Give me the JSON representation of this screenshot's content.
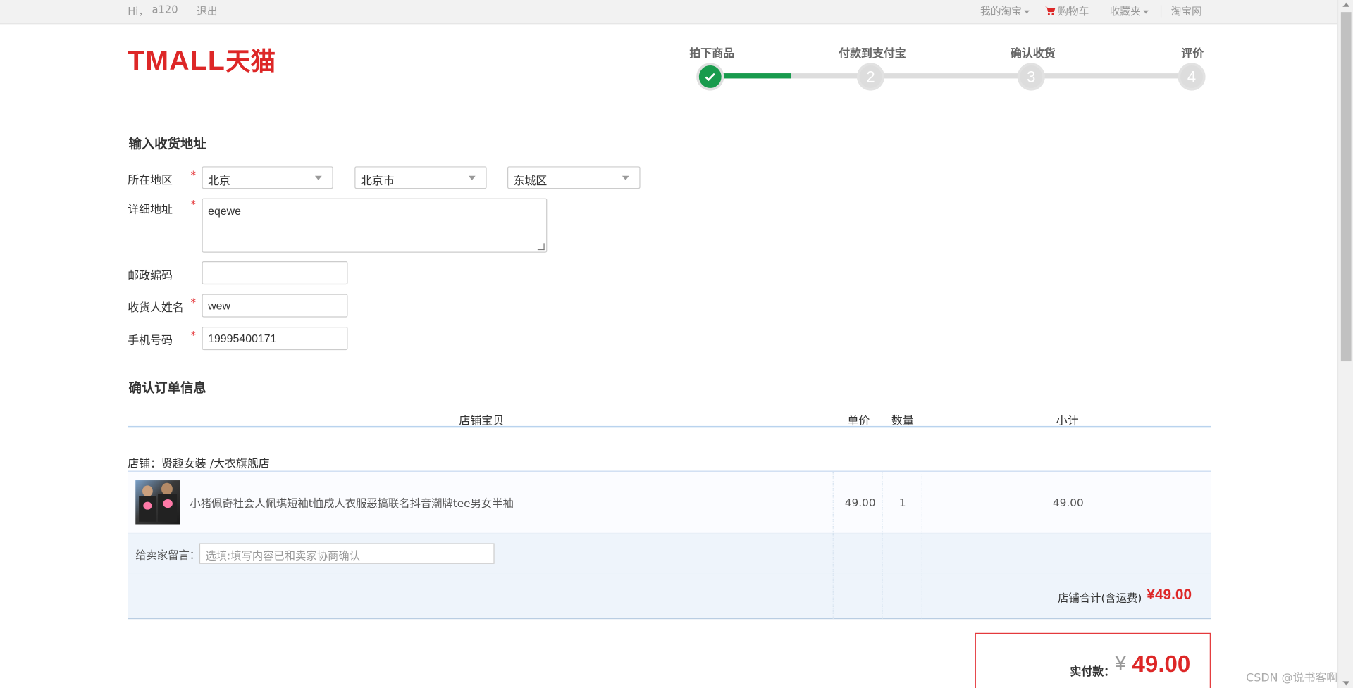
{
  "topbar": {
    "greeting": "Hi，",
    "username": "a120",
    "logout": "退出",
    "my_taobao": "我的淘宝",
    "cart": "购物车",
    "favorites": "收藏夹",
    "taobao_site": "淘宝网"
  },
  "logo": {
    "latin": "TMALL",
    "cn": "天猫"
  },
  "steps": [
    {
      "label": "拍下商品",
      "number": "",
      "done": true
    },
    {
      "label": "付款到支付宝",
      "number": "2",
      "done": false
    },
    {
      "label": "确认收货",
      "number": "3",
      "done": false
    },
    {
      "label": "评价",
      "number": "4",
      "done": false
    }
  ],
  "address": {
    "title": "输入收货地址",
    "region_label": "所在地区",
    "province": "北京",
    "city": "北京市",
    "district": "东城区",
    "detail_label": "详细地址",
    "detail_value": "eqewe",
    "postcode_label": "邮政编码",
    "postcode_value": "",
    "receiver_label": "收货人姓名",
    "receiver_value": "wew",
    "phone_label": "手机号码",
    "phone_value": "19995400171",
    "required_mark": "*"
  },
  "order": {
    "title": "确认订单信息",
    "headers": {
      "item": "店铺宝贝",
      "price": "单价",
      "qty": "数量",
      "subtotal": "小计"
    },
    "shop": "店铺：贤趣女装 /大衣旗舰店",
    "item": {
      "title": "小猪佩奇社会人佩琪短袖t恤成人衣服恶搞联名抖音潮牌tee男女半袖",
      "price": "49.00",
      "qty": "1",
      "subtotal": "49.00"
    },
    "message_label": "给卖家留言：",
    "message_placeholder": "选填:填写内容已和卖家协商确认",
    "shop_total_label": "店铺合计(含运费)",
    "shop_total": "¥49.00"
  },
  "payment": {
    "label": "实付款：",
    "currency": "¥",
    "amount": "49.00"
  },
  "watermark": "CSDN @说书客啊",
  "colors": {
    "brand": "#dd2727",
    "step_done": "#189b4d",
    "table_head_line": "#b9d3ee"
  }
}
